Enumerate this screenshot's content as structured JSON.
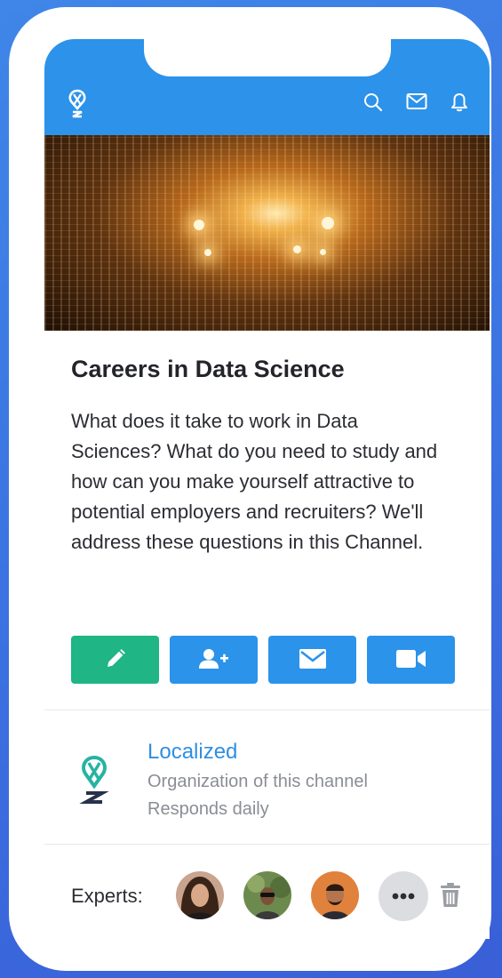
{
  "icons": {
    "brand": "localized-logo-icon",
    "search": "search-icon",
    "messages": "envelope-icon",
    "notifications": "bell-icon"
  },
  "colors": {
    "primary": "#2c92ea",
    "edit_button": "#1fb584",
    "org_link": "#2f8fe0",
    "muted_text": "#8a8d95"
  },
  "channel": {
    "title": "Careers in Data Science",
    "description": "What does it take to work in Data Sciences? What do you need to study and how can you make yourself attractive to potential employers and recruiters? We'll address these questions in this Channel."
  },
  "actions": [
    {
      "icon": "pencil-icon"
    },
    {
      "icon": "add-user-icon"
    },
    {
      "icon": "envelope-icon"
    },
    {
      "icon": "video-camera-icon"
    }
  ],
  "organization": {
    "name": "Localized",
    "role": "Organization of this channel",
    "response": "Responds daily"
  },
  "experts": {
    "label": "Experts:",
    "more_icon": "more-icon",
    "delete_icon": "trash-icon"
  }
}
